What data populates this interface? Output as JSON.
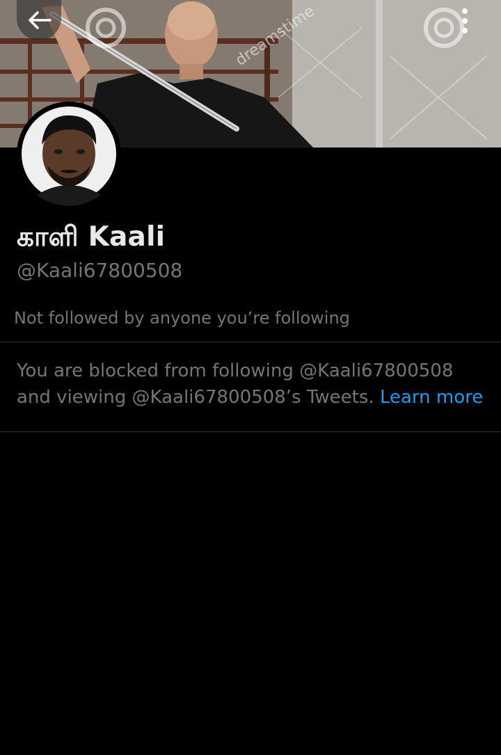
{
  "header": {
    "back_icon": "arrow-left-icon",
    "more_icon": "more-vertical-icon",
    "banner_watermark": "dreamstime"
  },
  "profile": {
    "display_name": "காளி Kaali",
    "handle": "@Kaali67800508",
    "followed_note": "Not followed by anyone you’re following"
  },
  "blocked_notice": {
    "line1": "You are blocked from following @Kaali67800508",
    "line2": "and viewing @Kaali67800508’s Tweets.",
    "link_label": "Learn more"
  },
  "colors": {
    "background": "#000000",
    "primary_text": "#e7e9ea",
    "secondary_text": "#71767b",
    "link": "#1d9bf0",
    "divider": "#2f3336"
  }
}
